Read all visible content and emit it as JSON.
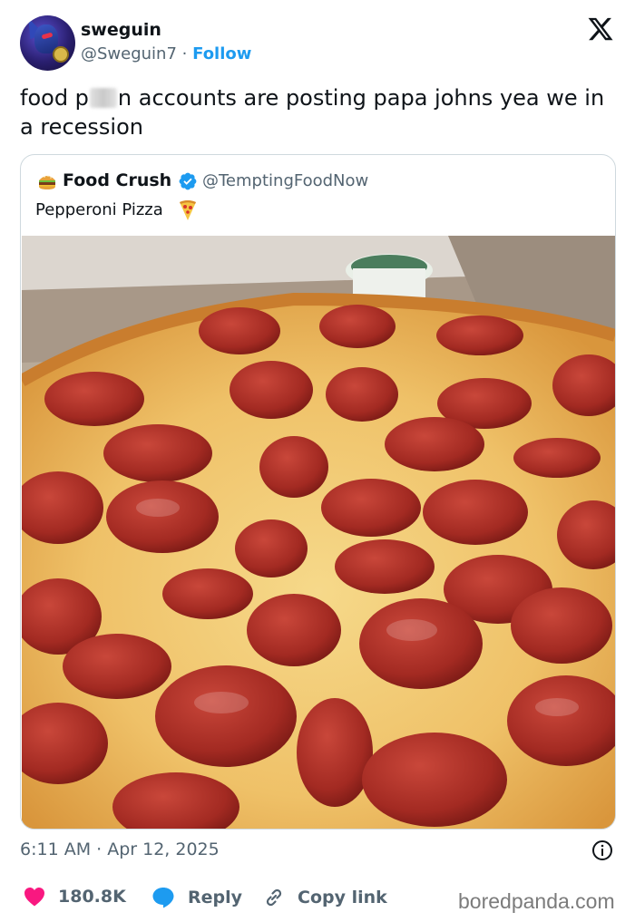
{
  "author": {
    "display_name": "sweguin",
    "handle": "@Sweguin7",
    "separator": "·",
    "follow_label": "Follow"
  },
  "tweet": {
    "text_part1": "food p",
    "text_part2": "n accounts are posting papa johns yea we in a recession"
  },
  "quoted": {
    "display_name": "Food Crush",
    "handle": "@TemptingFoodNow",
    "text": "Pepperoni Pizza",
    "avatar_icon": "burger-icon",
    "emoji_icon": "pizza-slice-icon"
  },
  "meta": {
    "timestamp": "6:11 AM · Apr 12, 2025"
  },
  "actions": {
    "likes": "180.8K",
    "reply_label": "Reply",
    "copy_label": "Copy link"
  },
  "watermark": "boredpanda.com",
  "colors": {
    "accent": "#1d9bf0",
    "like": "#f91880",
    "secondary_text": "#536471"
  }
}
